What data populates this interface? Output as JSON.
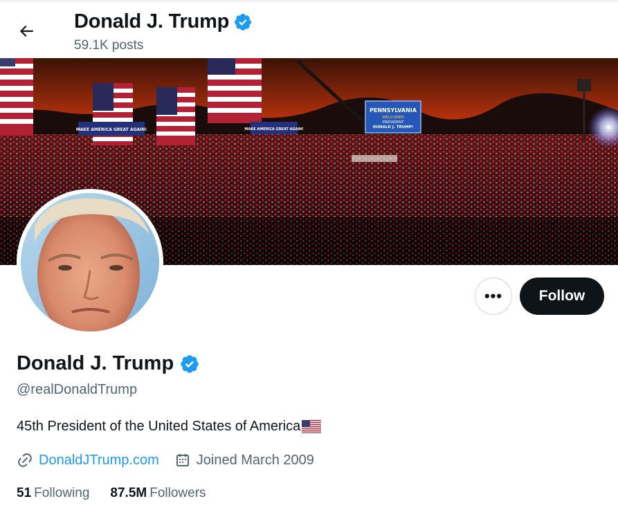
{
  "header": {
    "name": "Donald J. Trump",
    "posts": "59.1K posts"
  },
  "banner": {
    "screen_line1": "PENNSYLVANIA",
    "screen_line2": "WELCOMES",
    "screen_line3": "PRESIDENT",
    "screen_line4": "DONALD J. TRUMP!",
    "sign_left": "MAKE AMERICA GREAT AGAIN!",
    "sign_right": "MAKE AMERICA GREAT AGAIN!"
  },
  "actions": {
    "more_label": "•••",
    "follow_label": "Follow"
  },
  "profile": {
    "name": "Donald J. Trump",
    "handle": "@realDonaldTrump",
    "bio": "45th President of the United States of America",
    "website": "DonaldJTrump.com",
    "joined": "Joined March 2009"
  },
  "stats": {
    "following_count": "51",
    "following_label": "Following",
    "followers_count": "87.5M",
    "followers_label": "Followers"
  },
  "colors": {
    "accent": "#1d9bf0",
    "text_primary": "#0f1419",
    "text_secondary": "#536471",
    "follow_button": "#0f1419"
  },
  "icons": {
    "back": "arrow-left-icon",
    "verified": "verified-badge-icon",
    "link": "link-icon",
    "calendar": "calendar-icon",
    "flag": "us-flag-emoji"
  }
}
